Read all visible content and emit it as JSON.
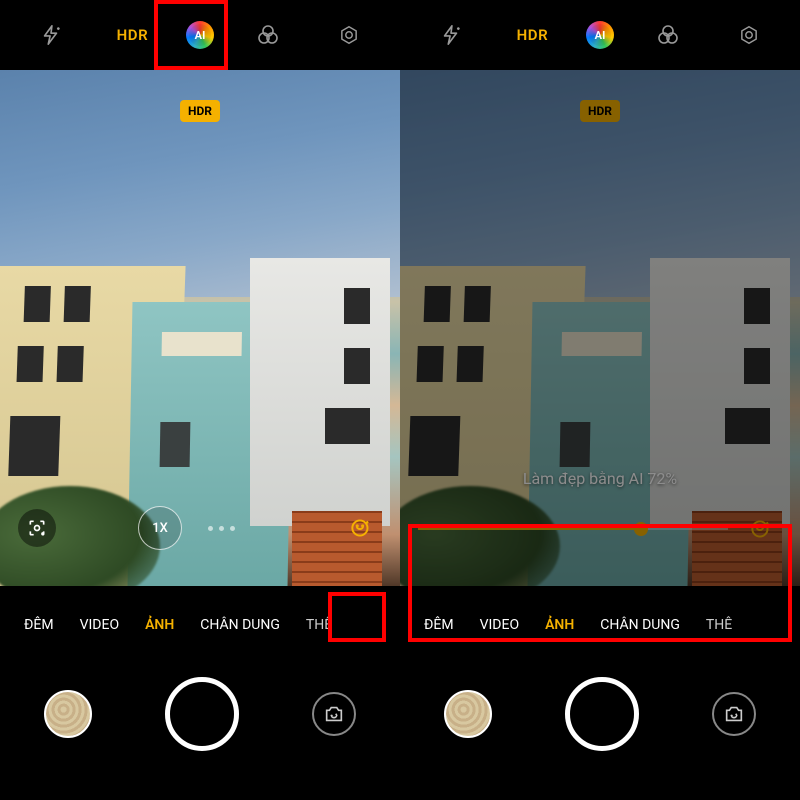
{
  "topbar": {
    "hdr_label": "HDR",
    "ai_label": "AI"
  },
  "viewfinder": {
    "hdr_badge": "HDR",
    "zoom_label": "1X"
  },
  "beauty": {
    "label_template": "Làm đẹp bằng AI 72%",
    "percent": 72
  },
  "modes": {
    "items": [
      "ĐÊM",
      "VIDEO",
      "ẢNH",
      "CHÂN DUNG",
      "THÊM"
    ],
    "active_index": 2
  }
}
